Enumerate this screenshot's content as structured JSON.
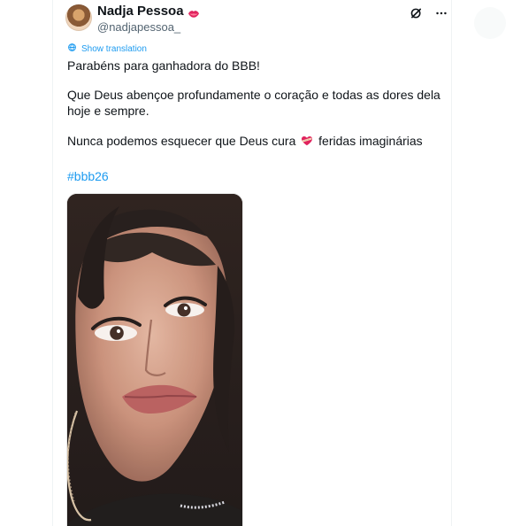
{
  "tweet": {
    "author": {
      "display_name": "Nadja Pessoa",
      "handle": "@nadjapessoa_",
      "verified_icon": "lips-icon"
    },
    "actions": {
      "grok_icon": "grok-icon",
      "more_icon": "more-icon"
    },
    "translation_label": "Show translation",
    "paragraphs": [
      "Parabéns para ganhadora do BBB!",
      "Que Deus abençoe profundamente o coração e todas as dores dela hoje e sempre.",
      "Nunca podemos esquecer que Deus cura ",
      " feridas imaginárias"
    ],
    "hashtag": "#bbb26",
    "inline_icon": "heart-bandage-icon",
    "media_alt": "Photo"
  },
  "colors": {
    "link": "#1d9bf0",
    "text": "#0f1419",
    "secondary": "#536471",
    "border": "#eff3f4"
  }
}
